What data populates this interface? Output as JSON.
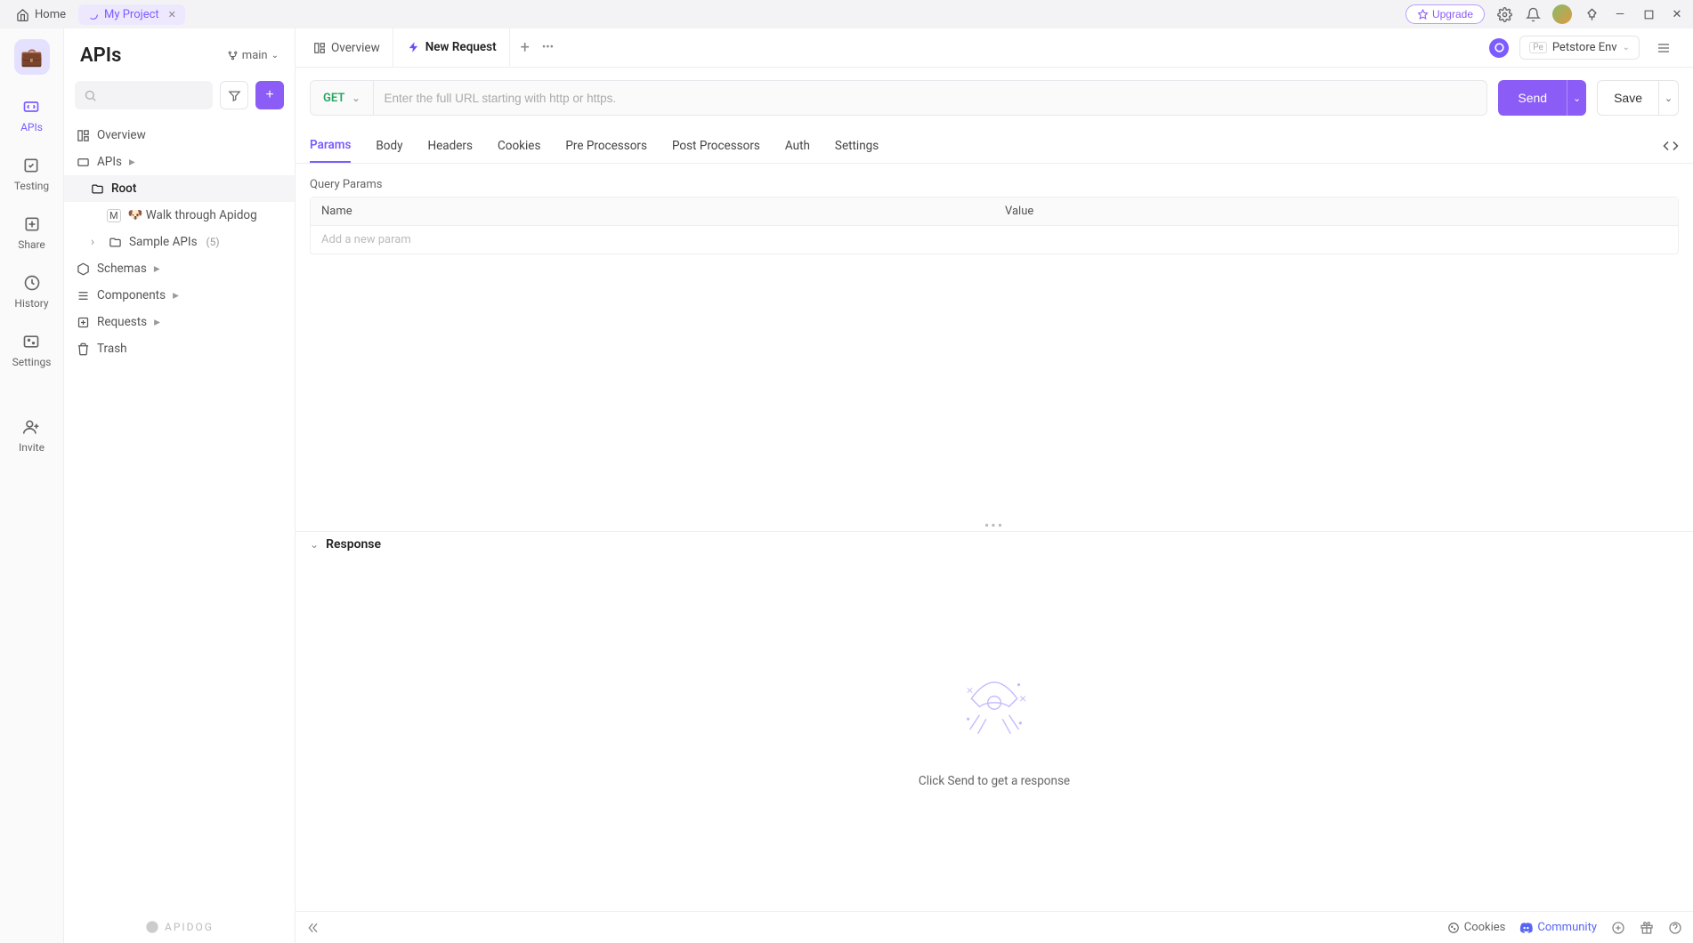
{
  "titlebar": {
    "home_label": "Home",
    "project_label": "My Project",
    "upgrade_label": "Upgrade"
  },
  "leftrail": {
    "items": [
      {
        "label": "APIs",
        "icon": "api"
      },
      {
        "label": "Testing",
        "icon": "testing"
      },
      {
        "label": "Share",
        "icon": "share"
      },
      {
        "label": "History",
        "icon": "history"
      },
      {
        "label": "Settings",
        "icon": "settings"
      },
      {
        "label": "Invite",
        "icon": "invite"
      }
    ]
  },
  "sidebar": {
    "title": "APIs",
    "branch": "main",
    "search_placeholder": "",
    "tree": {
      "overview": "Overview",
      "apis": "APIs",
      "root": "Root",
      "walk_through": "🐶 Walk through Apidog",
      "sample_apis": "Sample APIs",
      "sample_apis_count": "(5)",
      "schemas": "Schemas",
      "components": "Components",
      "requests": "Requests",
      "trash": "Trash"
    },
    "footer_brand": "APIDOG"
  },
  "tabs": {
    "overview": "Overview",
    "new_request": "New Request"
  },
  "env": {
    "name": "Petstore Env"
  },
  "request": {
    "method": "GET",
    "url_placeholder": "Enter the full URL starting with http or https.",
    "send_label": "Send",
    "save_label": "Save"
  },
  "subtabs": {
    "params": "Params",
    "body": "Body",
    "headers": "Headers",
    "cookies": "Cookies",
    "pre_processors": "Pre Processors",
    "post_processors": "Post Processors",
    "auth": "Auth",
    "settings": "Settings"
  },
  "params_section": {
    "title": "Query Params",
    "col_name": "Name",
    "col_value": "Value",
    "add_placeholder": "Add a new param"
  },
  "response": {
    "title": "Response",
    "empty_message": "Click Send to get a response"
  },
  "footer": {
    "cookies": "Cookies",
    "community": "Community"
  }
}
